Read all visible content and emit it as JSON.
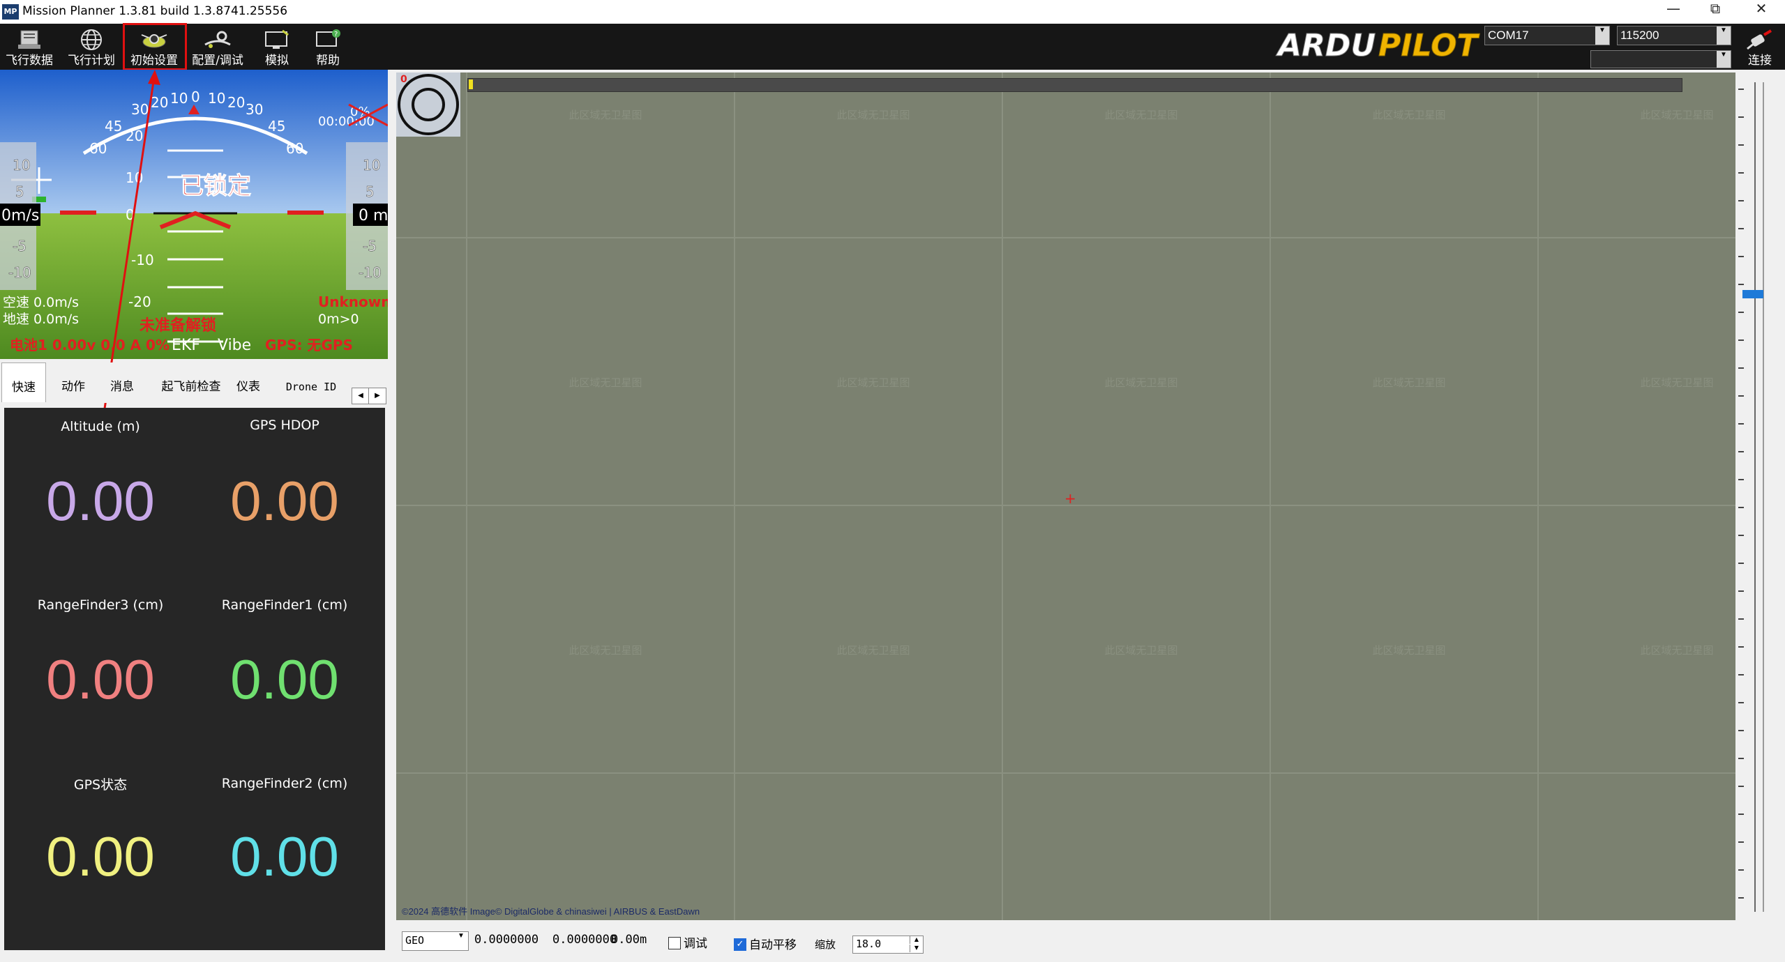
{
  "window": {
    "title": "Mission Planner 1.3.81 build 1.3.8741.25556",
    "app_icon_text": "MP",
    "controls": [
      "minimize-icon",
      "restore-icon",
      "close-icon"
    ]
  },
  "toolbar": {
    "buttons": [
      {
        "label": "飞行数据",
        "icon": "flight-data-icon"
      },
      {
        "label": "飞行计划",
        "icon": "globe-icon"
      },
      {
        "label": "初始设置",
        "icon": "initial-setup-icon"
      },
      {
        "label": "配置/调试",
        "icon": "config-tuning-icon"
      },
      {
        "label": "模拟",
        "icon": "simulation-icon"
      },
      {
        "label": "帮助",
        "icon": "help-icon"
      }
    ],
    "logo_text": "ARDUPILOT",
    "port_value": "COM17",
    "baud_value": "115200",
    "connect_label": "连接",
    "accent": "#e01010"
  },
  "hud": {
    "heading_scale": [
      "60",
      "45",
      "30",
      "20",
      "10",
      "0",
      "10",
      "20",
      "30",
      "45",
      "60"
    ],
    "pitch_ticks": [
      "20",
      "10",
      "0",
      "-10",
      "-20"
    ],
    "left_tape": [
      "10",
      "5",
      "0m/s",
      "-5",
      "-10"
    ],
    "right_tape": [
      "10",
      "5",
      "0 m",
      "-5",
      "-10"
    ],
    "status_big": "已锁定",
    "airspeed": "空速 0.0m/s",
    "groundspeed": "地速 0.0m/s",
    "not_ready": "未准备解锁",
    "battery": "电池1 0.00v 0.0 A 0%",
    "ekf": "EKF",
    "vibe": "Vibe",
    "gps": "GPS: 无GPS",
    "mode": "Unknown",
    "wp_dist": "0m>0",
    "time": "00:00:00",
    "pct": "0%"
  },
  "tabs": [
    {
      "label": "快速",
      "active": true
    },
    {
      "label": "动作",
      "active": false
    },
    {
      "label": "消息",
      "active": false
    },
    {
      "label": "起飞前检查",
      "active": false
    },
    {
      "label": "仪表",
      "active": false
    },
    {
      "label": "Drone ID",
      "active": false
    }
  ],
  "quick": [
    {
      "label": "Altitude (m)",
      "value": "0.00",
      "color": "#c8a8e8"
    },
    {
      "label": "GPS HDOP",
      "value": "0.00",
      "color": "#e8a068"
    },
    {
      "label": "RangeFinder3 (cm)",
      "value": "0.00",
      "color": "#f08080"
    },
    {
      "label": "RangeFinder1 (cm)",
      "value": "0.00",
      "color": "#70e070"
    },
    {
      "label": "GPS状态",
      "value": "0.00",
      "color": "#f0f080"
    },
    {
      "label": "RangeFinder2 (cm)",
      "value": "0.00",
      "color": "#60e0e8"
    }
  ],
  "map": {
    "corner_counter": "0",
    "watermark": "此区域无卫星图",
    "credits": "©2024 高德软件 Image© DigitalGlobe & chinasiwei | AIRBUS & EastDawn",
    "background": "#7b8170"
  },
  "bottom": {
    "coord_type": "GEO",
    "lat": "0.0000000",
    "lng": "0.0000000",
    "alt": "0.00m",
    "debug_label": "调试",
    "debug_checked": false,
    "autopan_label": "自动平移",
    "autopan_checked": true,
    "zoom_label": "缩放",
    "zoom_value": "18.0"
  }
}
